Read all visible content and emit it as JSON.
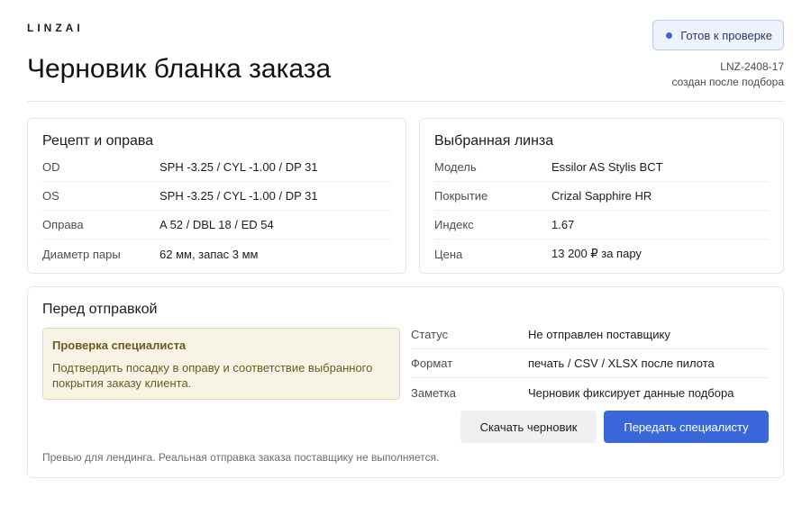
{
  "brand": "LINZAI",
  "status": {
    "label": "Готов к проверке",
    "dot_color": "#3a66d8"
  },
  "title": "Черновик бланка заказа",
  "order": {
    "id": "LNZ-2408-17",
    "note": "создан после подбора"
  },
  "prescription": {
    "title": "Рецепт и оправа",
    "rows": [
      {
        "key": "OD",
        "value": "SPH -3.25 / CYL -1.00 / DP 31"
      },
      {
        "key": "OS",
        "value": "SPH -3.25 / CYL -1.00 / DP 31"
      },
      {
        "key": "Оправа",
        "value": "A 52 / DBL 18 / ED 54"
      },
      {
        "key": "Диаметр пары",
        "value": "62 мм, запас 3 мм"
      }
    ]
  },
  "lens": {
    "title": "Выбранная линза",
    "rows": [
      {
        "key": "Модель",
        "value": "Essilor AS Stylis BCT"
      },
      {
        "key": "Покрытие",
        "value": "Crizal Sapphire HR"
      },
      {
        "key": "Индекс",
        "value": "1.67"
      },
      {
        "key": "Цена",
        "value": "13 200 ₽ за пару"
      }
    ]
  },
  "send": {
    "title": "Перед отправкой",
    "notice": {
      "title": "Проверка специалиста",
      "text": "Подтвердить посадку в оправу и соответствие выбранного покрытия заказу клиента."
    },
    "rows": [
      {
        "key": "Статус",
        "value": "Не отправлен поставщику"
      },
      {
        "key": "Формат",
        "value": "печать / CSV / XLSX после пилота"
      },
      {
        "key": "Заметка",
        "value": "Черновик фиксирует данные подбора"
      }
    ],
    "download_label": "Скачать черновик",
    "submit_label": "Передать специалисту",
    "footnote": "Превью для лендинга. Реальная отправка заказа поставщику не выполняется."
  },
  "colors": {
    "accent": "#3a67da",
    "notice_bg": "#f7f4e6",
    "notice_text": "#6b5a1e"
  }
}
